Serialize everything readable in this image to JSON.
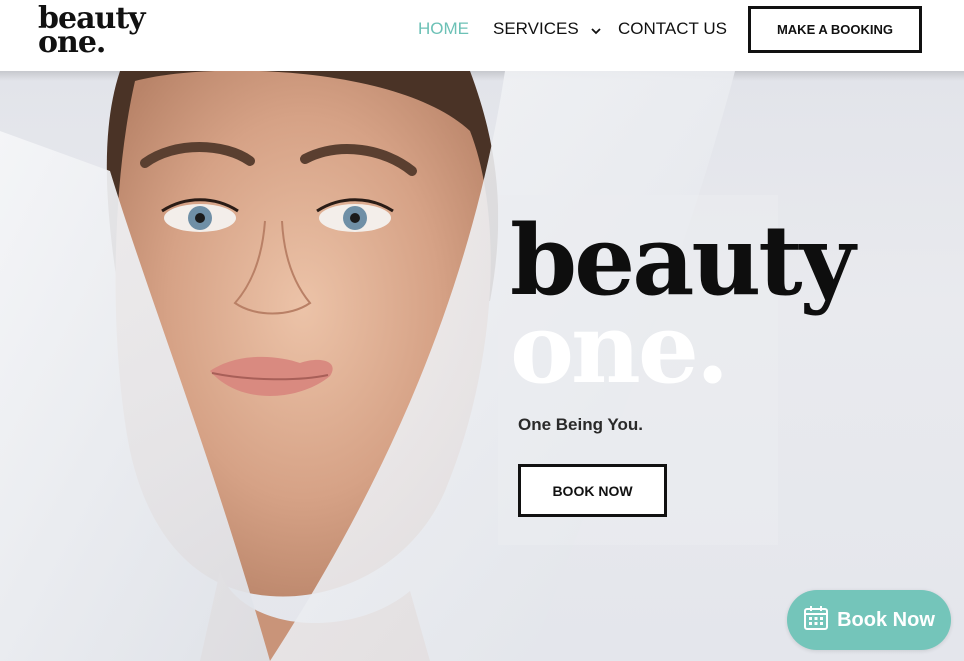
{
  "brand": {
    "logo_line1": "beauty",
    "logo_line2": "one."
  },
  "nav": {
    "home": "HOME",
    "services": "SERVICES",
    "contact": "CONTACT US",
    "booking": "MAKE A BOOKING"
  },
  "hero": {
    "word1": "beauty",
    "word2": "one.",
    "tagline": "One Being You.",
    "cta": "BOOK NOW"
  },
  "floating": {
    "label": "Book Now",
    "icon": "calendar-icon"
  },
  "colors": {
    "accent": "#6cc1b6",
    "float_bg": "#74c5ba",
    "text": "#111111"
  }
}
